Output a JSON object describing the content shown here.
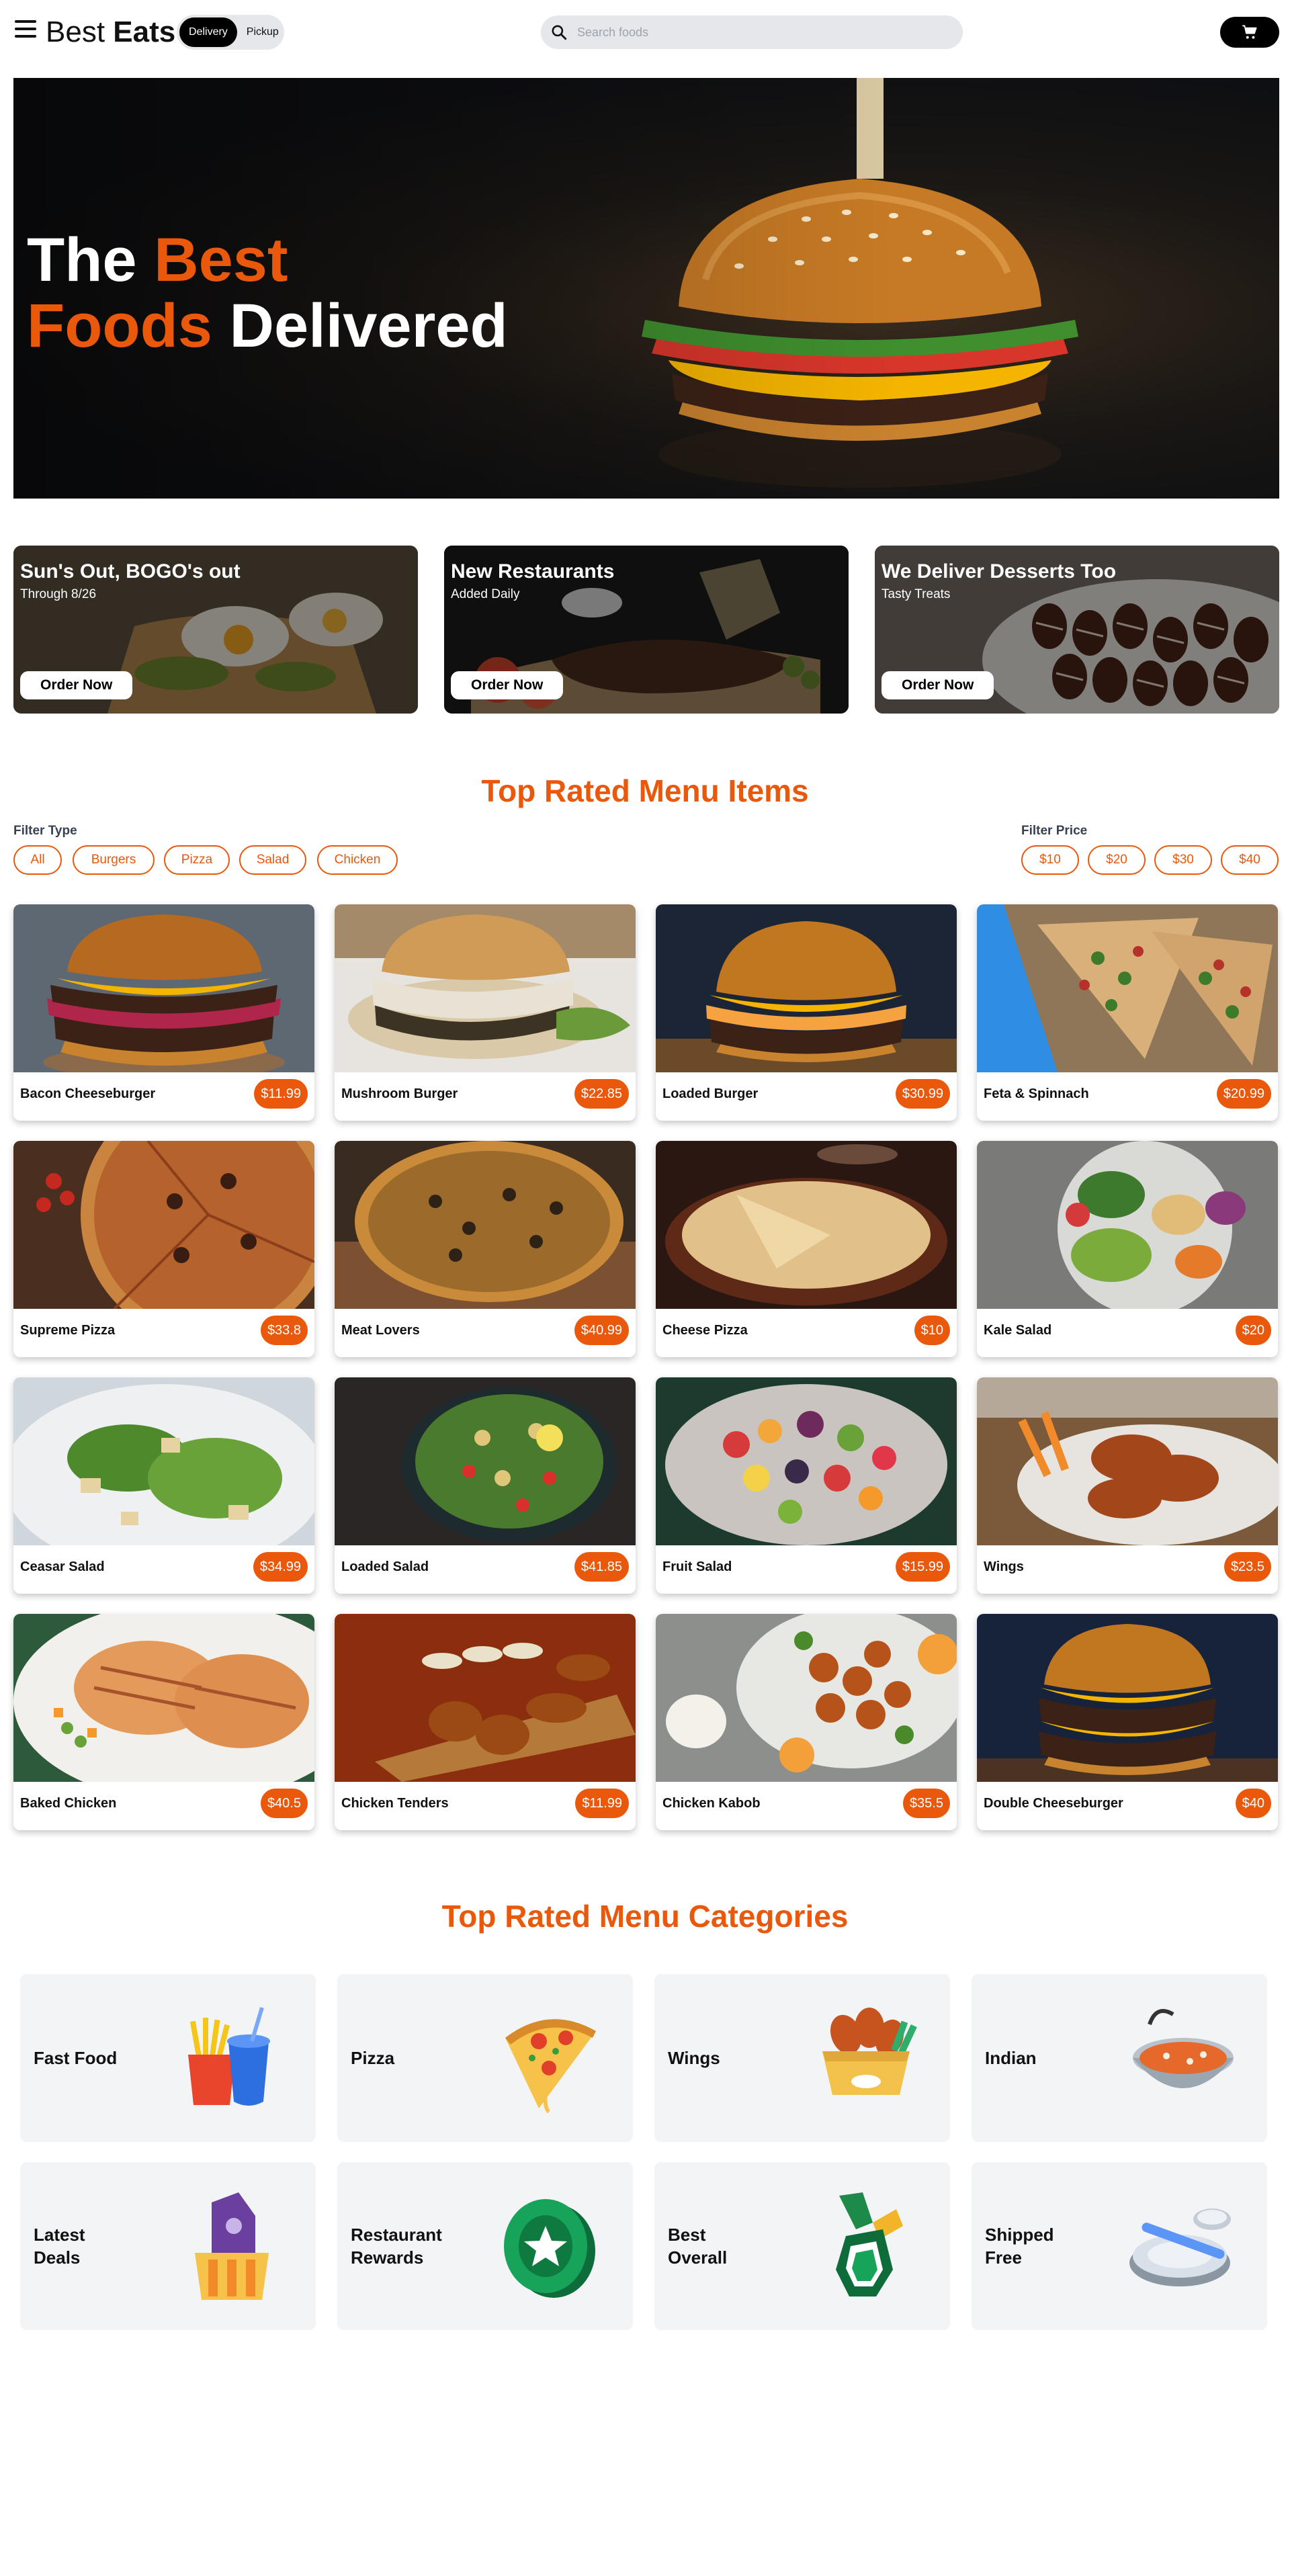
{
  "header": {
    "brand_regular": "Best",
    "brand_bold": "Eats",
    "mode_active": "Delivery",
    "mode_inactive": "Pickup",
    "search_placeholder": "Search foods"
  },
  "hero": {
    "line1_white": "The",
    "line1_accent": "Best",
    "line2_accent": "Foods",
    "line2_white": "Delivered"
  },
  "promos": [
    {
      "title": "Sun's Out, BOGO's out",
      "subtitle": "Through 8/26",
      "button": "Order Now"
    },
    {
      "title": "New Restaurants",
      "subtitle": "Added Daily",
      "button": "Order Now"
    },
    {
      "title": "We Deliver Desserts Too",
      "subtitle": "Tasty Treats",
      "button": "Order Now"
    }
  ],
  "menu_section": {
    "title": "Top Rated Menu Items",
    "filter_type_label": "Filter Type",
    "filter_types": [
      "All",
      "Burgers",
      "Pizza",
      "Salad",
      "Chicken"
    ],
    "filter_price_label": "Filter Price",
    "filter_prices": [
      "$10",
      "$20",
      "$30",
      "$40"
    ]
  },
  "menu_items": [
    {
      "name": "Bacon Cheeseburger",
      "price": "$11.99"
    },
    {
      "name": "Mushroom Burger",
      "price": "$22.85"
    },
    {
      "name": "Loaded Burger",
      "price": "$30.99"
    },
    {
      "name": "Feta & Spinnach",
      "price": "$20.99"
    },
    {
      "name": "Supreme Pizza",
      "price": "$33.8"
    },
    {
      "name": "Meat Lovers",
      "price": "$40.99"
    },
    {
      "name": "Cheese Pizza",
      "price": "$10"
    },
    {
      "name": "Kale Salad",
      "price": "$20"
    },
    {
      "name": "Ceasar Salad",
      "price": "$34.99"
    },
    {
      "name": "Loaded Salad",
      "price": "$41.85"
    },
    {
      "name": "Fruit Salad",
      "price": "$15.99"
    },
    {
      "name": "Wings",
      "price": "$23.5"
    },
    {
      "name": "Baked Chicken",
      "price": "$40.5"
    },
    {
      "name": "Chicken Tenders",
      "price": "$11.99"
    },
    {
      "name": "Chicken Kabob",
      "price": "$35.5"
    },
    {
      "name": "Double Cheeseburger",
      "price": "$40"
    }
  ],
  "categories_section": {
    "title": "Top Rated Menu Categories",
    "items": [
      {
        "label": "Fast Food",
        "icon": "fast-food-icon"
      },
      {
        "label": "Pizza",
        "icon": "pizza-slice-icon"
      },
      {
        "label": "Wings",
        "icon": "wings-box-icon"
      },
      {
        "label": "Indian",
        "icon": "curry-bowl-icon"
      },
      {
        "label": "Latest Deals",
        "icon": "deal-tag-icon"
      },
      {
        "label": "Restaurant Rewards",
        "icon": "reward-star-icon"
      },
      {
        "label": "Best Overall",
        "icon": "medal-icon"
      },
      {
        "label": "Shipped Free",
        "icon": "plates-icon"
      }
    ]
  },
  "colors": {
    "accent": "#ea580c",
    "black": "#000000",
    "toggle_bg": "#e5e7eb",
    "category_bg": "#f3f4f6"
  }
}
